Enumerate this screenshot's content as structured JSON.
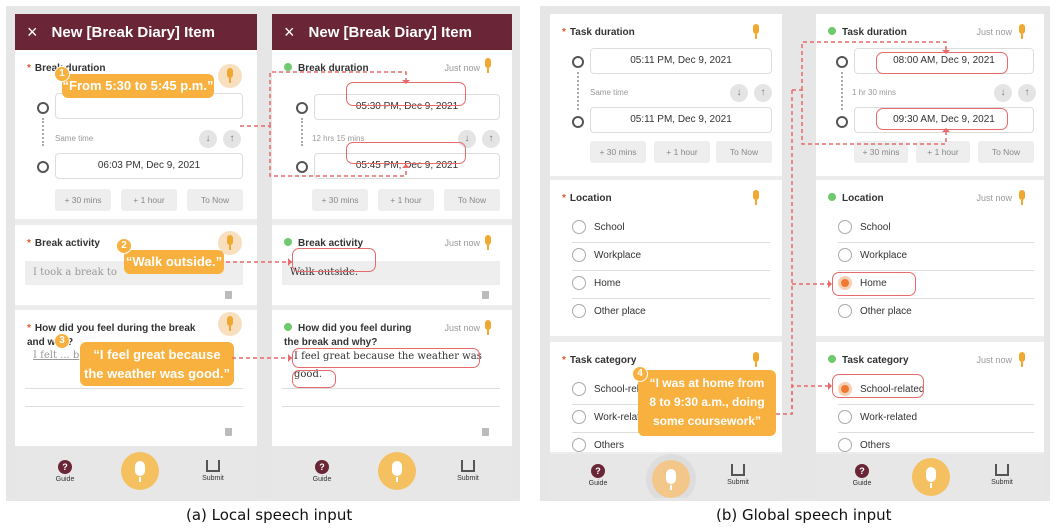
{
  "header": {
    "close": "×",
    "title": "New [Break Diary] Item"
  },
  "local": {
    "q_duration": "Break duration",
    "q_activity": "Break activity",
    "q_feel": "How did you feel during the break and why?",
    "same_time": "Same time",
    "end_time": "06:03 PM, Dec 9, 2021",
    "btn_30": "+ 30 mins",
    "btn_1h": "+ 1 hour",
    "btn_now": "To Now",
    "activity_text": "I took a break to",
    "feel_text": "I felt ... b",
    "bubble1": "“From 5:30 to 5:45 p.m.”",
    "bubble2": "“Walk outside.”",
    "bubble3a": "“I feel great because",
    "bubble3b": "the weather was good.”",
    "just_now": "Just now",
    "start2": "05:30 PM, Dec 9, 2021",
    "span2": "12 hrs 15 mins",
    "end2": "05:45 PM, Dec 9, 2021",
    "activity2": "Walk outside.",
    "feel2a": "I feel great because the weather was",
    "feel2b": "good."
  },
  "global": {
    "q_task_duration": "Task duration",
    "q_location": "Location",
    "q_category": "Task category",
    "start1": "05:11 PM, Dec 9, 2021",
    "same_time": "Same time",
    "end1": "05:11 PM, Dec 9, 2021",
    "btn_30": "+ 30 mins",
    "btn_1h": "+ 1 hour",
    "btn_now": "To Now",
    "loc_options": [
      "School",
      "Workplace",
      "Home",
      "Other place"
    ],
    "cat_options": [
      "School-related",
      "Work-related",
      "Others"
    ],
    "just_now": "Just now",
    "start2": "08:00 AM, Dec 9, 2021",
    "span2": "1 hr 30 mins",
    "end2": "09:30 AM, Dec 9, 2021",
    "bubble4a": "“I was at home from",
    "bubble4b": "8 to 9:30 a.m., doing",
    "bubble4c": "some coursework”"
  },
  "bar": {
    "guide": "Guide",
    "submit": "Submit"
  },
  "captions": {
    "a": "(a) Local speech input",
    "b": "(b) Global speech input"
  },
  "nums": [
    "1",
    "2",
    "3",
    "4"
  ],
  "colors": {
    "header": "#6a2637",
    "accent": "#f8b03e",
    "highlight": "#e86a6a",
    "selected": "#f07830",
    "done_dot": "#6fc96d"
  }
}
